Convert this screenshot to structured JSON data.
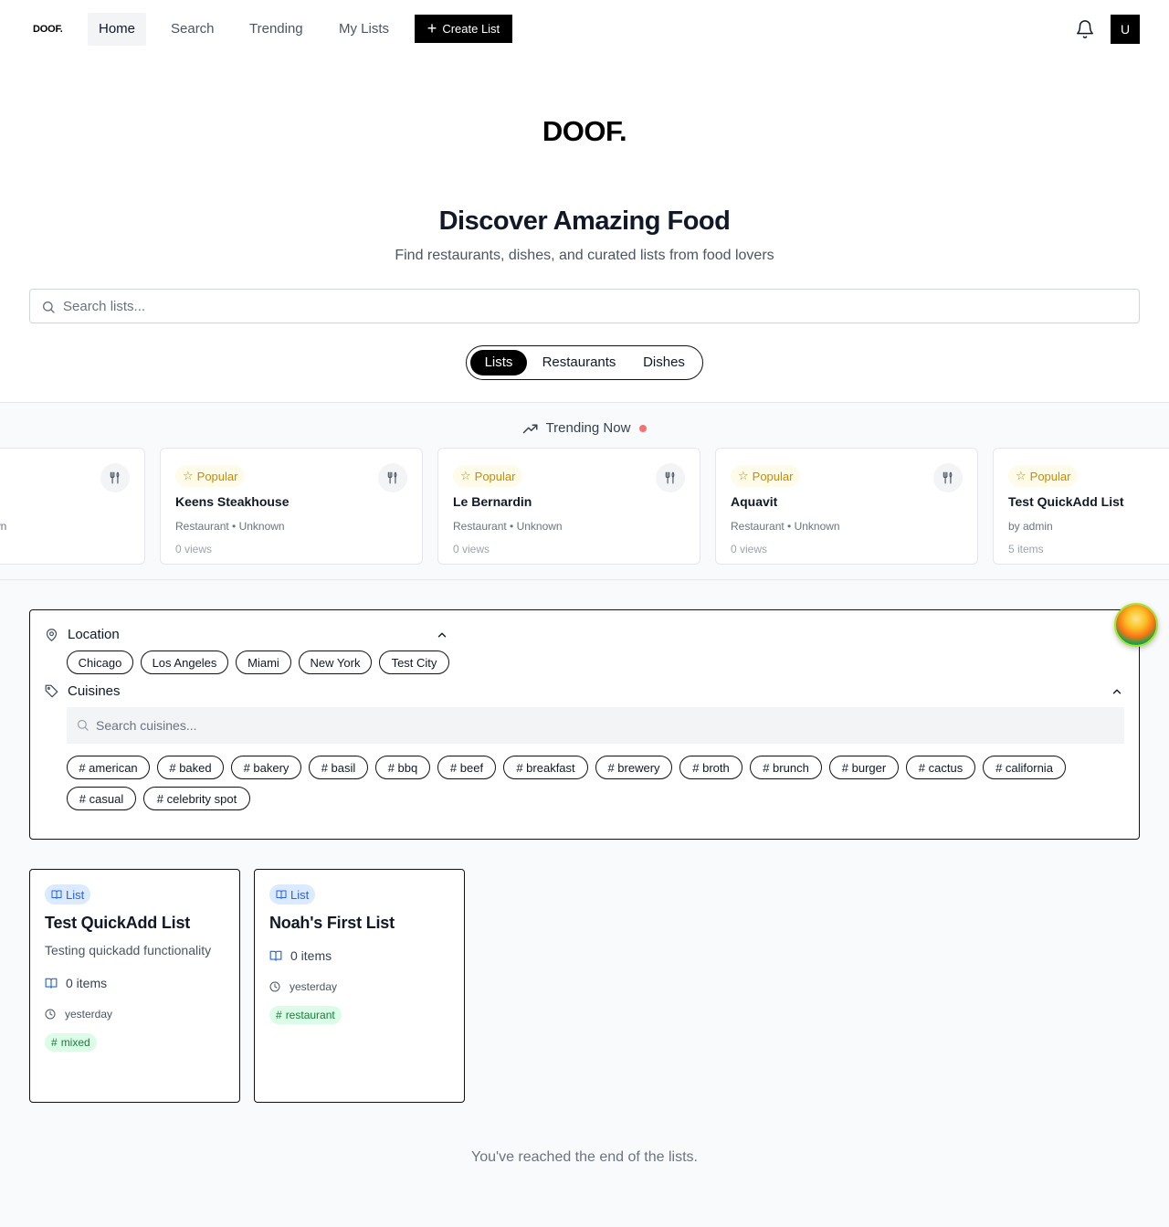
{
  "nav": {
    "logo": "DOOF.",
    "links": [
      "Home",
      "Search",
      "Trending",
      "My Lists"
    ],
    "create_label": "Create List",
    "avatar_initial": "U"
  },
  "hero": {
    "logo": "DOOF.",
    "title": "Discover Amazing Food",
    "subtitle": "Find restaurants, dishes, and curated lists from food lovers",
    "search_placeholder": "Search lists...",
    "tabs": [
      "Lists",
      "Restaurants",
      "Dishes"
    ],
    "active_tab": "Lists"
  },
  "trending": {
    "title": "Trending Now",
    "partial_meta": "wn",
    "cards": [
      {
        "badge": "Popular",
        "name": "Keens Steakhouse",
        "meta": "Restaurant • Unknown",
        "stat": "0 views"
      },
      {
        "badge": "Popular",
        "name": "Le Bernardin",
        "meta": "Restaurant • Unknown",
        "stat": "0 views"
      },
      {
        "badge": "Popular",
        "name": "Aquavit",
        "meta": "Restaurant • Unknown",
        "stat": "0 views"
      },
      {
        "badge": "Popular",
        "name": "Test QuickAdd List",
        "meta": "by admin",
        "stat": "5 items"
      }
    ]
  },
  "filters": {
    "location_title": "Location",
    "locations": [
      "Chicago",
      "Los Angeles",
      "Miami",
      "New York",
      "Test City"
    ],
    "cuisines_title": "Cuisines",
    "cuisine_search_placeholder": "Search cuisines...",
    "cuisines": [
      "# american",
      "# baked",
      "# bakery",
      "# basil",
      "# bbq",
      "# beef",
      "# breakfast",
      "# brewery",
      "# broth",
      "# brunch",
      "# burger",
      "# cactus",
      "# california",
      "# casual",
      "# celebrity spot"
    ]
  },
  "lists": [
    {
      "badge": "List",
      "title": "Test QuickAdd List",
      "description": "Testing quickadd functionality",
      "items": "0 items",
      "date": "yesterday",
      "tag": "mixed"
    },
    {
      "badge": "List",
      "title": "Noah's First List",
      "description": "",
      "items": "0 items",
      "date": "yesterday",
      "tag": "restaurant"
    }
  ],
  "end_message": "You've reached the end of the lists.",
  "colors": {
    "accent": "#000000",
    "popular": "#ca8a04",
    "list_badge": "#2563eb",
    "tag": "#15803d",
    "live_dot": "#f87171"
  }
}
